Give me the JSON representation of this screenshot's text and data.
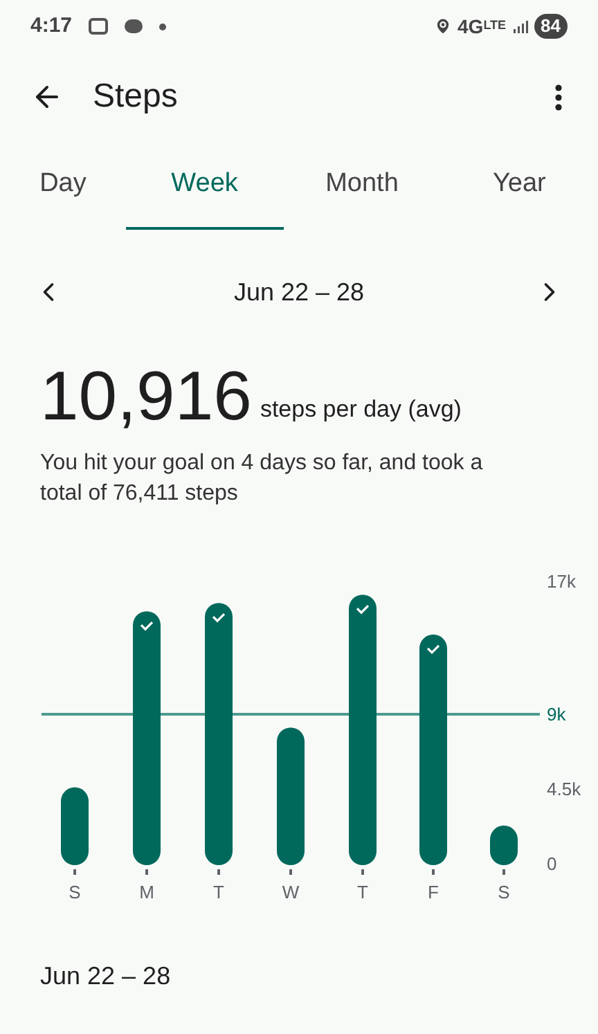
{
  "status_bar": {
    "time": "4:17",
    "network": "4G",
    "network_sub": "LTE",
    "battery": "84"
  },
  "header": {
    "title": "Steps"
  },
  "tabs": [
    {
      "label": "Day",
      "selected": false
    },
    {
      "label": "Week",
      "selected": true
    },
    {
      "label": "Month",
      "selected": false
    },
    {
      "label": "Year",
      "selected": false
    }
  ],
  "range": {
    "label": "Jun 22 – 28"
  },
  "summary": {
    "value": "10,916",
    "unit": "steps per day (avg)",
    "description": "You hit your goal on 4 days so far, and took a total of 76,411 steps"
  },
  "chart": {
    "goal_met": [
      false,
      true,
      true,
      false,
      true,
      true,
      false
    ],
    "chart_data": {
      "type": "bar",
      "categories": [
        "S",
        "M",
        "T",
        "W",
        "T",
        "F",
        "S"
      ],
      "series": [
        {
          "color": "#00695c",
          "values": [
            4600,
            15200,
            15700,
            8200,
            16200,
            13800,
            2300
          ]
        }
      ],
      "ylim": [
        0,
        17000
      ],
      "yticks": [
        0,
        {
          "value": 4500,
          "label": "4.5k"
        },
        {
          "value": 9000,
          "label": "9k"
        },
        {
          "value": 17000,
          "label": "17k"
        }
      ],
      "ref_lines": [
        {
          "axis": "y",
          "value": 9000,
          "color": "#4e9b8e"
        }
      ]
    }
  },
  "section": {
    "title": "Jun 22 – 28"
  }
}
